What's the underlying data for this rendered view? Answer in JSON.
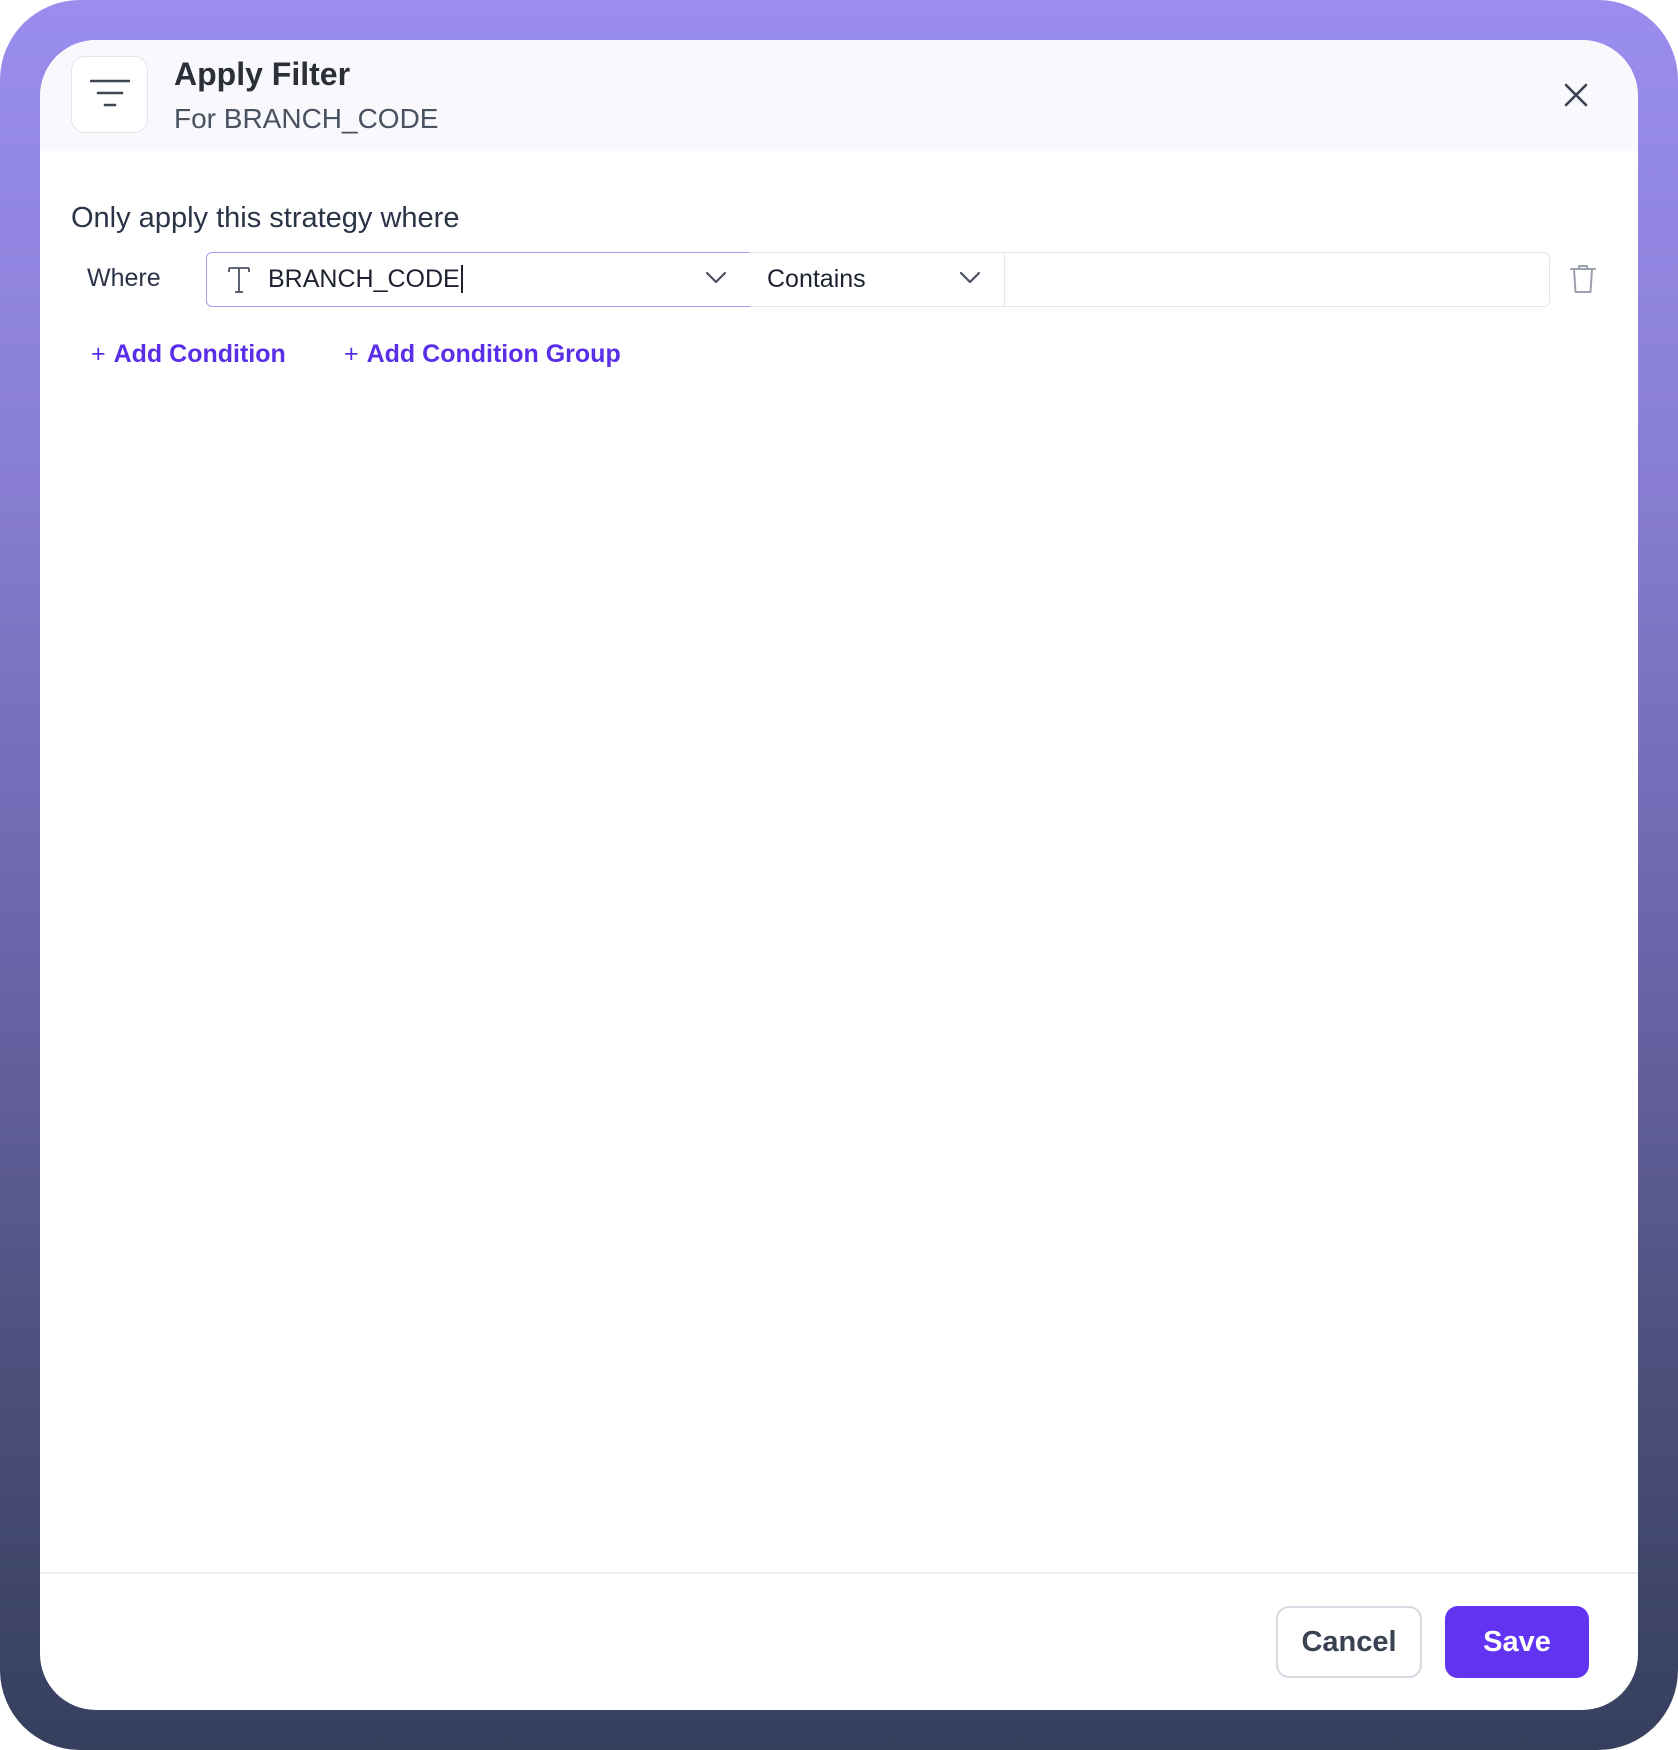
{
  "dialog": {
    "title": "Apply Filter",
    "subtitle": "For BRANCH_CODE",
    "icon": "filter-lines-icon",
    "close_icon": "close-icon"
  },
  "condition_section": {
    "heading": "Only apply this strategy where",
    "rows": [
      {
        "prefix_label": "Where",
        "field": {
          "type_icon": "text-type-icon",
          "value": "BRANCH_CODE"
        },
        "operator": {
          "value": "Contains"
        },
        "value_input": {
          "value": "",
          "placeholder": ""
        },
        "delete_icon": "trash-icon"
      }
    ],
    "add_condition_label": "Add Condition",
    "add_condition_group_label": "Add Condition Group"
  },
  "footer": {
    "cancel_label": "Cancel",
    "save_label": "Save"
  },
  "colors": {
    "accent": "#6234f2",
    "link": "#5a2ee8",
    "focus_border": "#a99cf5",
    "header_bg": "#f8f8fd"
  }
}
